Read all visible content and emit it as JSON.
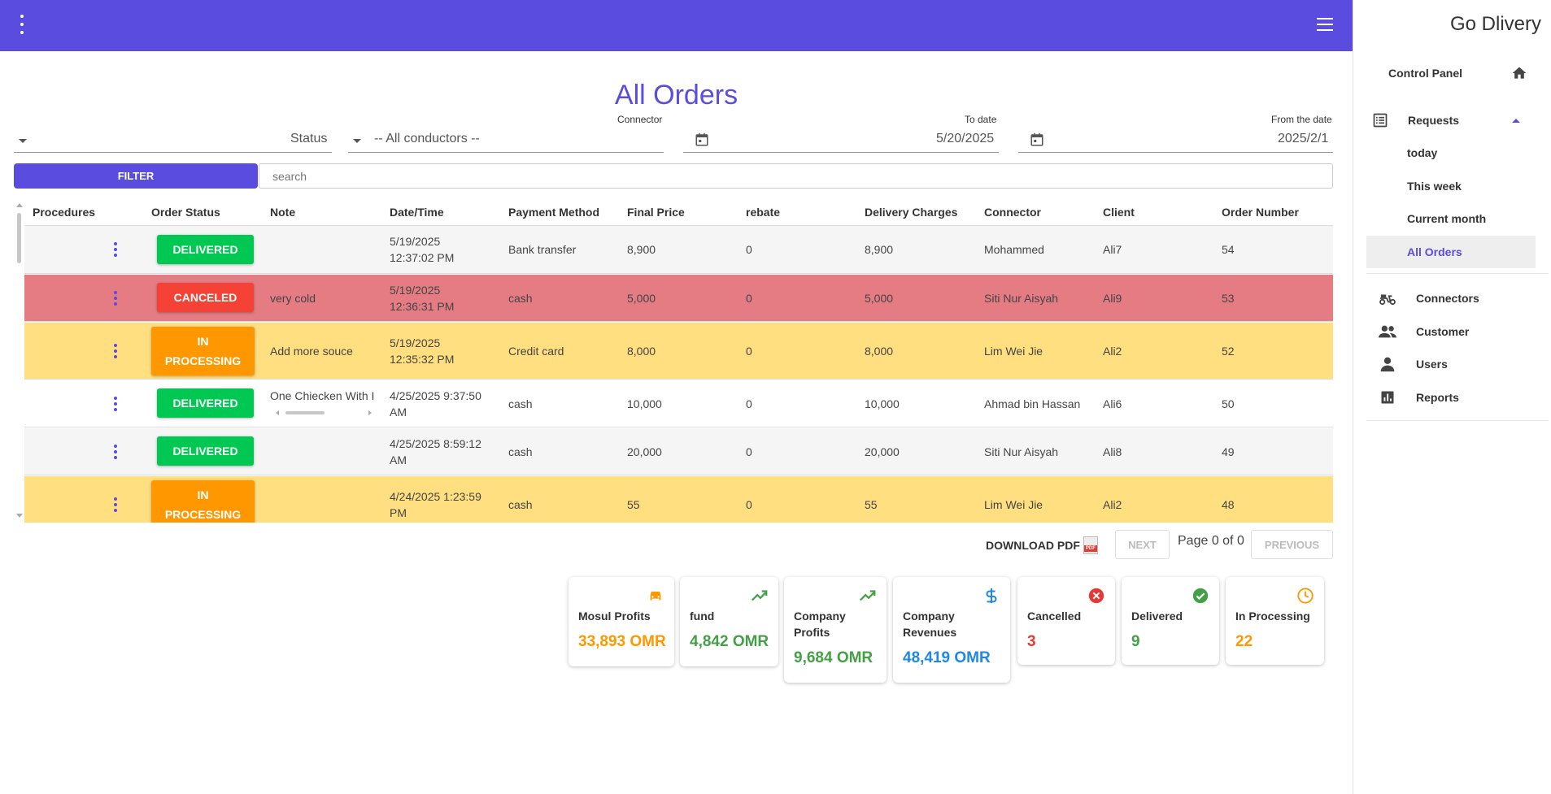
{
  "sidebar": {
    "brand": "Go Dlivery",
    "control_panel": "Control Panel",
    "requests": "Requests",
    "sub": [
      "today",
      "This week",
      "Current month",
      "All Orders"
    ],
    "connectors": "Connectors",
    "customer": "Customer",
    "users": "Users",
    "reports": "Reports"
  },
  "page": {
    "title": "All Orders"
  },
  "filters": {
    "status_placeholder": "Status",
    "connector_label": "Connector",
    "connector_value": "-- All conductors --",
    "to_date_label": "To date",
    "to_date_value": "5/20/2025",
    "from_date_label": "From the date",
    "from_date_value": "2025/2/1",
    "filter_button": "FILTER",
    "search_placeholder": "search"
  },
  "table": {
    "headers": [
      "Procedures",
      "Order Status",
      "Note",
      "Date/Time",
      "Payment Method",
      "Final Price",
      "rebate",
      "Delivery Charges",
      "Connector",
      "Client",
      "Order Number"
    ],
    "rows": [
      {
        "status": "DELIVERED",
        "note": "",
        "date": "5/19/2025",
        "time": "12:37:02 PM",
        "payment": "Bank transfer",
        "final_price": "8,900",
        "rebate": "0",
        "delivery": "8,900",
        "connector": "Mohammed",
        "client": "Ali7",
        "order": "54"
      },
      {
        "status": "CANCELED",
        "note": "very cold",
        "date": "5/19/2025",
        "time": "12:36:31 PM",
        "payment": "cash",
        "final_price": "5,000",
        "rebate": "0",
        "delivery": "5,000",
        "connector": "Siti Nur Aisyah",
        "client": "Ali9",
        "order": "53"
      },
      {
        "status": "IN PROCESSING",
        "note": "Add more souce",
        "date": "5/19/2025",
        "time": "12:35:32 PM",
        "payment": "Credit card",
        "final_price": "8,000",
        "rebate": "0",
        "delivery": "8,000",
        "connector": "Lim Wei Jie",
        "client": "Ali2",
        "order": "52"
      },
      {
        "status": "DELIVERED",
        "note": "One Chiecken With I",
        "date": "4/25/2025 9:37:50",
        "time": "AM",
        "payment": "cash",
        "final_price": "10,000",
        "rebate": "0",
        "delivery": "10,000",
        "connector": "Ahmad bin Hassan",
        "client": "Ali6",
        "order": "50"
      },
      {
        "status": "DELIVERED",
        "note": "",
        "date": "4/25/2025 8:59:12",
        "time": "AM",
        "payment": "cash",
        "final_price": "20,000",
        "rebate": "0",
        "delivery": "20,000",
        "connector": "Siti Nur Aisyah",
        "client": "Ali8",
        "order": "49"
      },
      {
        "status": "IN PROCESSING",
        "note": "",
        "date": "4/24/2025 1:23:59",
        "time": "PM",
        "payment": "cash",
        "final_price": "55",
        "rebate": "0",
        "delivery": "55",
        "connector": "Lim Wei Jie",
        "client": "Ali2",
        "order": "48"
      }
    ]
  },
  "pager": {
    "download_pdf": "DOWNLOAD PDF",
    "pdf_icon_text": "PDF",
    "next": "NEXT",
    "page_info": "Page 0 of 0",
    "previous": "PREVIOUS"
  },
  "cards": [
    {
      "label": "Mosul Profits",
      "value": "33,893 OMR",
      "icon": "car-icon",
      "color": "#ff9800"
    },
    {
      "label": "fund",
      "value": "4,842 OMR",
      "icon": "trending-up-icon",
      "color": "#43a047"
    },
    {
      "label": "Company Profits",
      "value": "9,684 OMR",
      "icon": "trending-up-icon",
      "color": "#43a047"
    },
    {
      "label": "Company Revenues",
      "value": "48,419 OMR",
      "icon": "dollar-icon",
      "color": "#1e88e5"
    },
    {
      "label": "Cancelled",
      "value": "3",
      "icon": "cancel-icon",
      "color": "#e53935"
    },
    {
      "label": "Delivered",
      "value": "9",
      "icon": "check-circle-icon",
      "color": "#43a047"
    },
    {
      "label": "In Processing",
      "value": "22",
      "icon": "clock-icon",
      "color": "#ff9800"
    }
  ],
  "colors": {
    "accent": "#5b4ce0",
    "delivered": "#00c853",
    "canceled": "#f44336",
    "processing": "#ff9800",
    "row_canceled": "#e57c84",
    "row_processing": "#ffdf80",
    "row_alt": "#f5f5f5"
  }
}
